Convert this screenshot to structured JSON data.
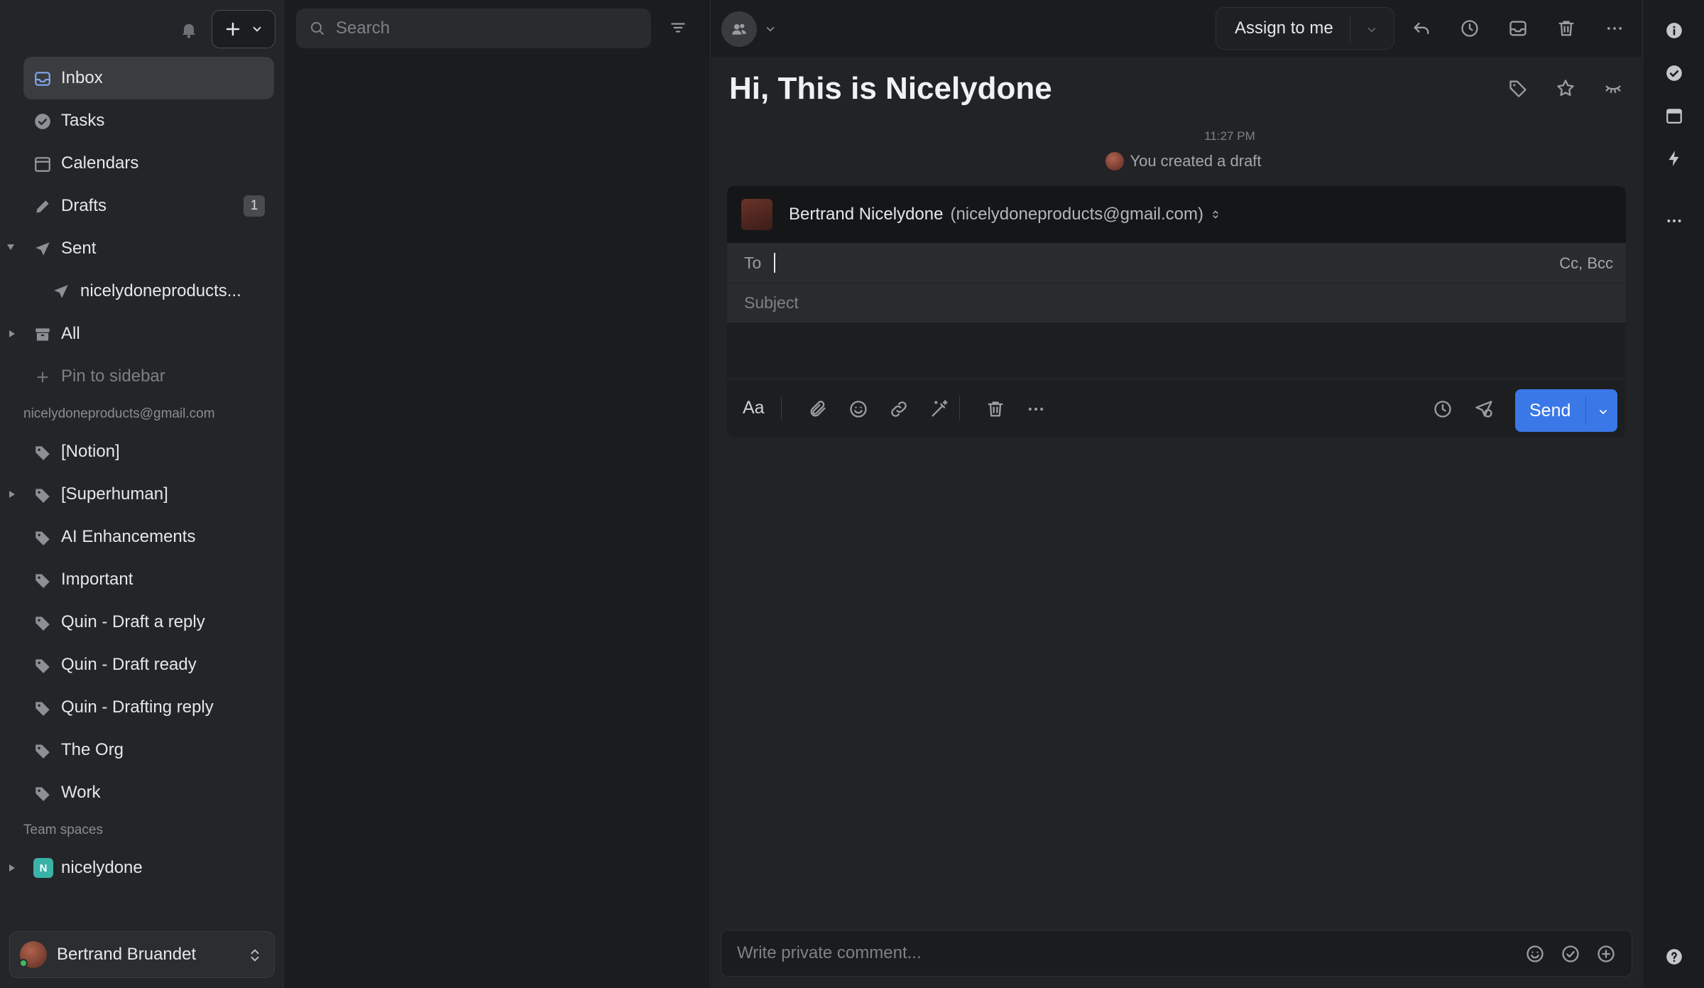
{
  "sidebar": {
    "items": [
      {
        "label": "Inbox",
        "icon": "inbox-icon"
      },
      {
        "label": "Tasks",
        "icon": "task-check-icon"
      },
      {
        "label": "Calendars",
        "icon": "calendar-icon"
      },
      {
        "label": "Drafts",
        "icon": "pencil-icon",
        "badge": "1"
      },
      {
        "label": "Sent",
        "icon": "send-icon"
      },
      {
        "label": "nicelydoneproducts...",
        "icon": "send-icon"
      },
      {
        "label": "All",
        "icon": "archive-icon"
      },
      {
        "label": "Pin to sidebar",
        "icon": "plus-icon"
      }
    ],
    "account_label": "nicelydoneproducts@gmail.com",
    "labels": [
      "[Notion]",
      "[Superhuman]",
      "AI Enhancements",
      "Important",
      "Quin - Draft a reply",
      "Quin - Draft ready",
      "Quin - Drafting reply",
      "The Org",
      "Work"
    ],
    "team_spaces_label": "Team spaces",
    "team_space": {
      "initial": "N",
      "name": "nicelydone"
    },
    "user": {
      "name": "Bertrand Bruandet"
    }
  },
  "list": {
    "search_placeholder": "Search"
  },
  "main": {
    "assign_label": "Assign to me",
    "subject": "Hi, This is Nicelydone",
    "time": "11:27 PM",
    "activity": "You created a draft",
    "composer": {
      "from_name": "Bertrand Nicelydone",
      "from_email": "(nicelydoneproducts@gmail.com)",
      "to_label": "To",
      "cc_bcc": "Cc, Bcc",
      "subject_placeholder": "Subject",
      "format_label": "Aa",
      "send_label": "Send"
    },
    "comment_placeholder": "Write private comment..."
  },
  "colors": {
    "accent": "#3b78e7",
    "background": "#1b1c1e",
    "sidebar": "#242528",
    "team_space": "#3bb2a7"
  }
}
